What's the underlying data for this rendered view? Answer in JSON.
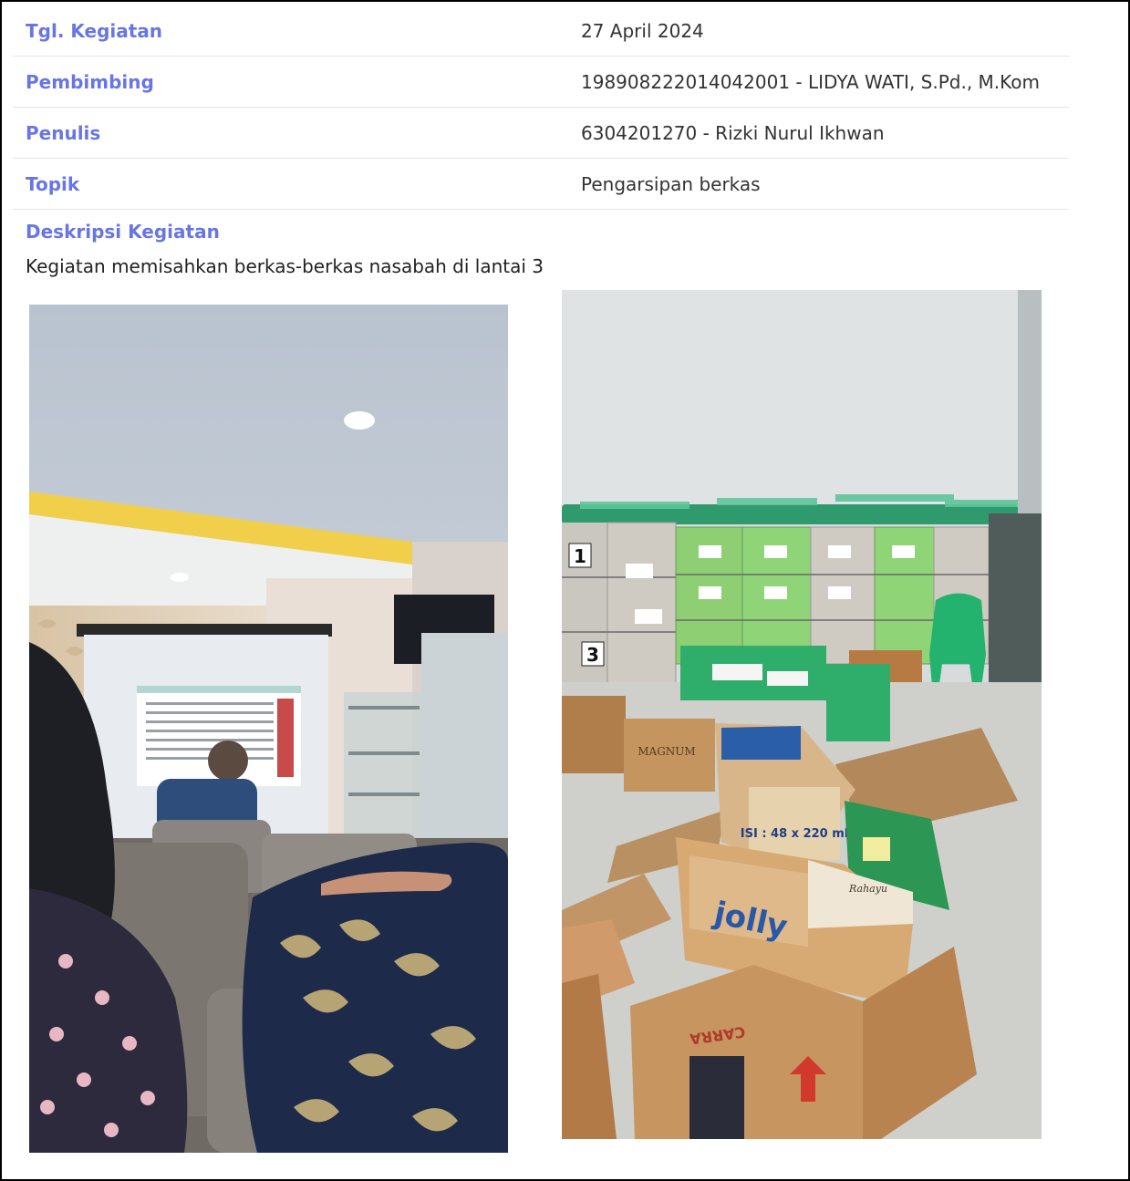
{
  "details": [
    {
      "label": "Tgl. Kegiatan",
      "value": "27 April 2024"
    },
    {
      "label": "Pembimbing",
      "value": "198908222014042001 - LIDYA WATI, S.Pd., M.Kom"
    },
    {
      "label": "Penulis",
      "value": "6304201270 - Rizki Nurul Ikhwan"
    },
    {
      "label": "Topik",
      "value": "Pengarsipan berkas"
    }
  ],
  "description": {
    "title": "Deskripsi Kegiatan",
    "text": "Kegiatan memisahkan berkas-berkas nasabah di lantai 3"
  },
  "photos": {
    "right": {
      "drawer_numbers": [
        "1",
        "3"
      ],
      "box_labels": [
        "jolly",
        "ISI : 48 x 220 ml",
        "MAGNUM",
        "CARRA",
        "Rahayu"
      ]
    }
  },
  "colors": {
    "label": "#6776e4",
    "text": "#333333",
    "row_border": "#e6e6e6"
  }
}
